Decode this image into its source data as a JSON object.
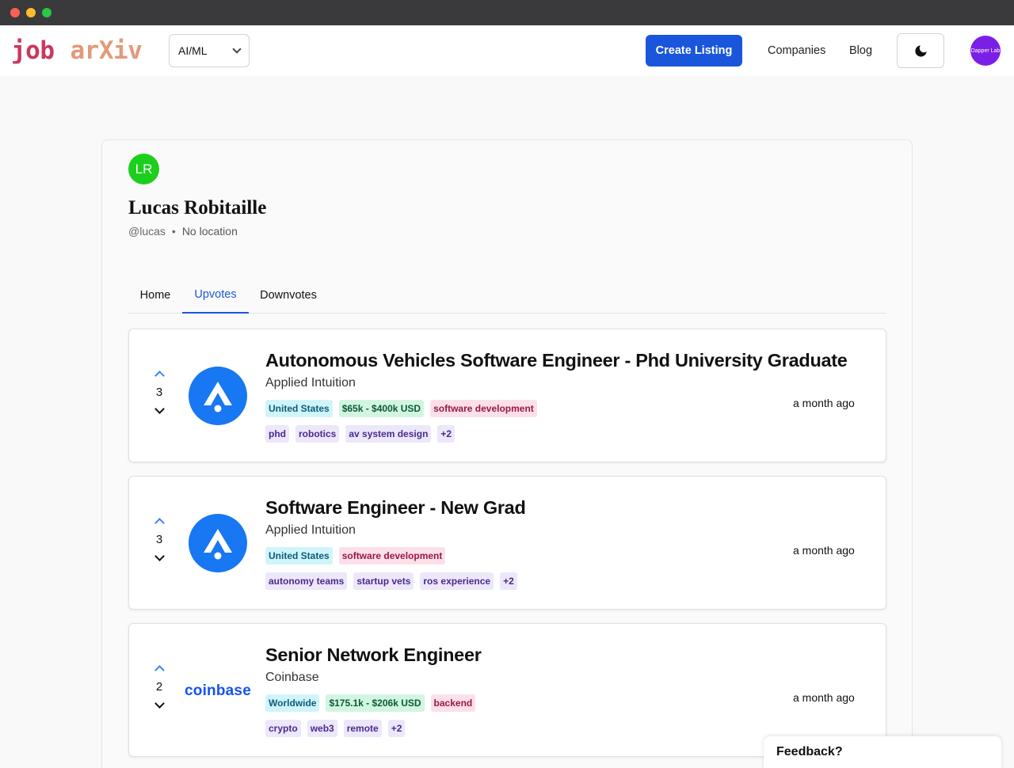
{
  "window": {
    "colors": {
      "close": "#fe5f57",
      "minimize": "#febc2e",
      "maximize": "#28c840"
    }
  },
  "header": {
    "logo_part1": "job",
    "logo_part2": "arXiv",
    "category_select": "AI/ML",
    "create_listing": "Create Listing",
    "companies": "Companies",
    "blog": "Blog",
    "theme_icon": "moon-icon",
    "user_avatar_text": "Dapper Lab",
    "colors": {
      "primary": "#1a56db",
      "avatar": "#7c1fe6"
    }
  },
  "profile": {
    "initials": "LR",
    "name": "Lucas Robitaille",
    "handle": "@lucas",
    "separator": "•",
    "location": "No location",
    "avatar_color": "#1ccf1c"
  },
  "tabs": [
    {
      "label": "Home",
      "active": false
    },
    {
      "label": "Upvotes",
      "active": true
    },
    {
      "label": "Downvotes",
      "active": false
    }
  ],
  "jobs": [
    {
      "votes": "3",
      "title": "Autonomous Vehicles Software Engineer - Phd University Graduate",
      "company": "Applied Intuition",
      "logo": "applied-intuition-logo",
      "tags_row1": [
        {
          "text": "United States",
          "kind": "loc"
        },
        {
          "text": "$65k - $400k USD",
          "kind": "sal"
        },
        {
          "text": "software development",
          "kind": "cat"
        }
      ],
      "tags_row2": [
        {
          "text": "phd",
          "kind": "skill"
        },
        {
          "text": "robotics",
          "kind": "skill"
        },
        {
          "text": "av system design",
          "kind": "skill"
        },
        {
          "text": "+2",
          "kind": "skill"
        }
      ],
      "posted": "a month ago"
    },
    {
      "votes": "3",
      "title": "Software Engineer - New Grad",
      "company": "Applied Intuition",
      "logo": "applied-intuition-logo",
      "tags_row1": [
        {
          "text": "United States",
          "kind": "loc"
        },
        {
          "text": "software development",
          "kind": "cat"
        }
      ],
      "tags_row2": [
        {
          "text": "autonomy teams",
          "kind": "skill"
        },
        {
          "text": "startup vets",
          "kind": "skill"
        },
        {
          "text": "ros experience",
          "kind": "skill"
        },
        {
          "text": "+2",
          "kind": "skill"
        }
      ],
      "posted": "a month ago"
    },
    {
      "votes": "2",
      "title": "Senior Network Engineer",
      "company": "Coinbase",
      "logo_text": "coinbase",
      "tags_row1": [
        {
          "text": "Worldwide",
          "kind": "loc"
        },
        {
          "text": "$175.1k - $206k USD",
          "kind": "sal"
        },
        {
          "text": "backend",
          "kind": "cat"
        }
      ],
      "tags_row2": [
        {
          "text": "crypto",
          "kind": "skill"
        },
        {
          "text": "web3",
          "kind": "skill"
        },
        {
          "text": "remote",
          "kind": "skill"
        },
        {
          "text": "+2",
          "kind": "skill"
        }
      ],
      "posted": "a month ago"
    }
  ],
  "feedback": {
    "label": "Feedback?"
  }
}
